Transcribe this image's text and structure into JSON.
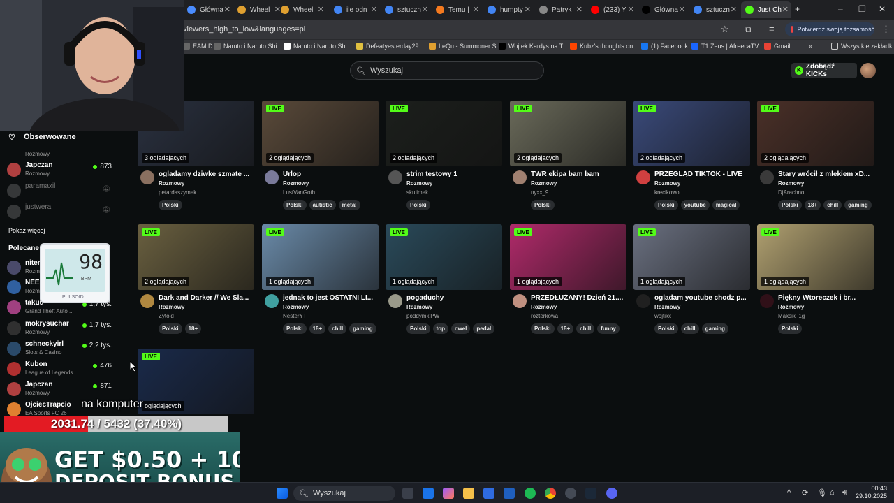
{
  "browser": {
    "tabs": [
      {
        "label": "Główna",
        "color": "#4a8cff"
      },
      {
        "label": "Wheel",
        "color": "#e0a030"
      },
      {
        "label": "Wheel",
        "color": "#e0a030"
      },
      {
        "label": "ile odn",
        "color": "#4285f4"
      },
      {
        "label": "sztuczn",
        "color": "#4285f4"
      },
      {
        "label": "Temu |",
        "color": "#f57a1f"
      },
      {
        "label": "humpty",
        "color": "#4285f4"
      },
      {
        "label": "Patryk",
        "color": "#888888"
      },
      {
        "label": "(233) Y",
        "color": "#ff0000"
      },
      {
        "label": "Główna",
        "color": "#000000"
      },
      {
        "label": "sztuczn",
        "color": "#4285f4"
      },
      {
        "label": "Just Ch",
        "color": "#53fc18"
      }
    ],
    "url": "viewers_high_to_low&languages=pl",
    "verify_label": "Potwierdź swoją tożsamość",
    "bookmarks": [
      {
        "label": "EAM D...",
        "color": "#666666"
      },
      {
        "label": "Naruto i Naruto Shi...",
        "color": "#666666"
      },
      {
        "label": "Naruto i Naruto Shi...",
        "color": "#ffffff"
      },
      {
        "label": "Defeatyesterday29...",
        "color": "#e0c040"
      },
      {
        "label": "LeQu - Summoner S...",
        "color": "#e0a030"
      },
      {
        "label": "Wojtek Kardys na T...",
        "color": "#000000"
      },
      {
        "label": "Kubz's thoughts on...",
        "color": "#ff4500"
      },
      {
        "label": "(1) Facebook",
        "color": "#1877f2"
      },
      {
        "label": "T1 Zeus | AfreecaTV...",
        "color": "#1a66ff"
      },
      {
        "label": "Gmail",
        "color": "#ea4335"
      }
    ],
    "all_bookmarks": "Wszystkie zakładki"
  },
  "header": {
    "search_placeholder": "Wyszukaj",
    "kicks_button": "Zdobądź KICKs"
  },
  "sidebar": {
    "followed_title": "Obserwowane",
    "show_more": "Pokaż więcej",
    "recommended_title": "Polecane",
    "followed": [
      {
        "name": "",
        "category": "Rozmowy",
        "viewers": "",
        "online": true
      },
      {
        "name": "Japczan",
        "category": "Rozmowy",
        "viewers": "873",
        "online": true
      },
      {
        "name": "paramaxil",
        "category": "",
        "viewers": "",
        "online": false
      },
      {
        "name": "justwera",
        "category": "",
        "viewers": "",
        "online": false
      }
    ],
    "recommended": [
      {
        "name": "nitem",
        "category": "Rozm",
        "viewers": ""
      },
      {
        "name": "NEE",
        "category": "Rozm",
        "viewers": ""
      },
      {
        "name": "takuu",
        "category": "Grand Theft Auto ...",
        "viewers": "1,7 tys."
      },
      {
        "name": "mokrysuchar",
        "category": "Rozmowy",
        "viewers": "1,7 tys."
      },
      {
        "name": "schneckyirl",
        "category": "Slots & Casino",
        "viewers": "2,2 tys."
      },
      {
        "name": "Kubon",
        "category": "League of Legends",
        "viewers": "476"
      },
      {
        "name": "Japczan",
        "category": "Rozmowy",
        "viewers": "871"
      },
      {
        "name": "OjciecTrapcio",
        "category": "EA Sports FC 26",
        "viewers": ""
      }
    ]
  },
  "live_label": "LIVE",
  "streams": [
    {
      "viewers": "3 oglądających",
      "title": "ogladamy dziwke szmate ...",
      "category": "Rozmowy",
      "user": "petardaszymek",
      "tags": [
        "Polski"
      ],
      "thumb": "#2a3140",
      "avatar": "#8a7060"
    },
    {
      "viewers": "2 oglądających",
      "title": "Urlop",
      "category": "Rozmowy",
      "user": "LustVanGoth",
      "tags": [
        "Polski",
        "autistic",
        "metal"
      ],
      "thumb": "#5a4a3a",
      "avatar": "#7a7a9a"
    },
    {
      "viewers": "2 oglądających",
      "title": "strim testowy 1",
      "category": "Rozmowy",
      "user": "skulimek",
      "tags": [
        "Polski"
      ],
      "thumb": "#1c1f1c",
      "avatar": "#555555"
    },
    {
      "viewers": "2 oglądających",
      "title": "TWR ekipa bam bam",
      "category": "Rozmowy",
      "user": "nyxx_9",
      "tags": [
        "Polski"
      ],
      "thumb": "#6a6a5a",
      "avatar": "#a08070"
    },
    {
      "viewers": "2 oglądających",
      "title": "PRZEGLĄD TIKTOK - LIVE",
      "category": "Rozmowy",
      "user": "krecikowo",
      "tags": [
        "Polski",
        "youtube",
        "magical"
      ],
      "thumb": "#3a4a7a",
      "avatar": "#d04040"
    },
    {
      "viewers": "2 oglądających",
      "title": "Stary wrócił z mlekiem xD...",
      "category": "Rozmowy",
      "user": "DjArachno",
      "tags": [
        "Polski",
        "18+",
        "chill",
        "gaming"
      ],
      "thumb": "#4a3028",
      "avatar": "#3a3a3a"
    },
    {
      "viewers": "2 oglądających",
      "title": "Dark and Darker // We Sla...",
      "category": "Rozmowy",
      "user": "Zytold",
      "tags": [
        "Polski",
        "18+"
      ],
      "thumb": "#6a6040",
      "avatar": "#b08840"
    },
    {
      "viewers": "1 oglądających",
      "title": "jednak to jest OSTATNI LI...",
      "category": "Rozmowy",
      "user": "NesterYT",
      "tags": [
        "Polski",
        "18+",
        "chill",
        "gaming"
      ],
      "thumb": "#6a8aa8",
      "avatar": "#40a0a0"
    },
    {
      "viewers": "1 oglądających",
      "title": "pogaduchy",
      "category": "Rozmowy",
      "user": "poddymkiPW",
      "tags": [
        "Polski",
        "top",
        "cwel",
        "pedał"
      ],
      "thumb": "#2a4a5a",
      "avatar": "#9a9a8a"
    },
    {
      "viewers": "1 oglądających",
      "title": "PRZEDŁUŻANY! Dzień 21....",
      "category": "Rozmowy",
      "user": "rozterkowa",
      "tags": [
        "Polski",
        "18+",
        "chill",
        "funny"
      ],
      "thumb": "#b02a6a",
      "avatar": "#c09080"
    },
    {
      "viewers": "1 oglądających",
      "title": "ogladam youtube chodz p...",
      "category": "Rozmowy",
      "user": "wojtikx",
      "tags": [
        "Polski",
        "chill",
        "gaming"
      ],
      "thumb": "#6a7080",
      "avatar": "#202020"
    },
    {
      "viewers": "1 oglądających",
      "title": "Piękny Wtoreczek i br...",
      "category": "Rozmowy",
      "user": "Maksik_1g",
      "tags": [
        "Polski"
      ],
      "thumb": "#b0a070",
      "avatar": "#301018"
    },
    {
      "viewers": "oglądających",
      "title": "",
      "category": "",
      "user": "",
      "tags": [],
      "thumb": "#1a2a4a",
      "avatar": "#333333"
    }
  ],
  "pulse": {
    "value": "98",
    "unit": "BPM",
    "brand": "PULSOID"
  },
  "overlay": {
    "caption": "na komputer",
    "progress_label": "2031.74 / 5432 (37.40%)",
    "progress_fraction": 0.374,
    "banner_line1": "GET $0.50 + 10%",
    "banner_line2": "DEPOSIT BONUS"
  },
  "taskbar": {
    "search": "Wyszukaj",
    "time": "00:43",
    "date": "29.10.2025"
  }
}
